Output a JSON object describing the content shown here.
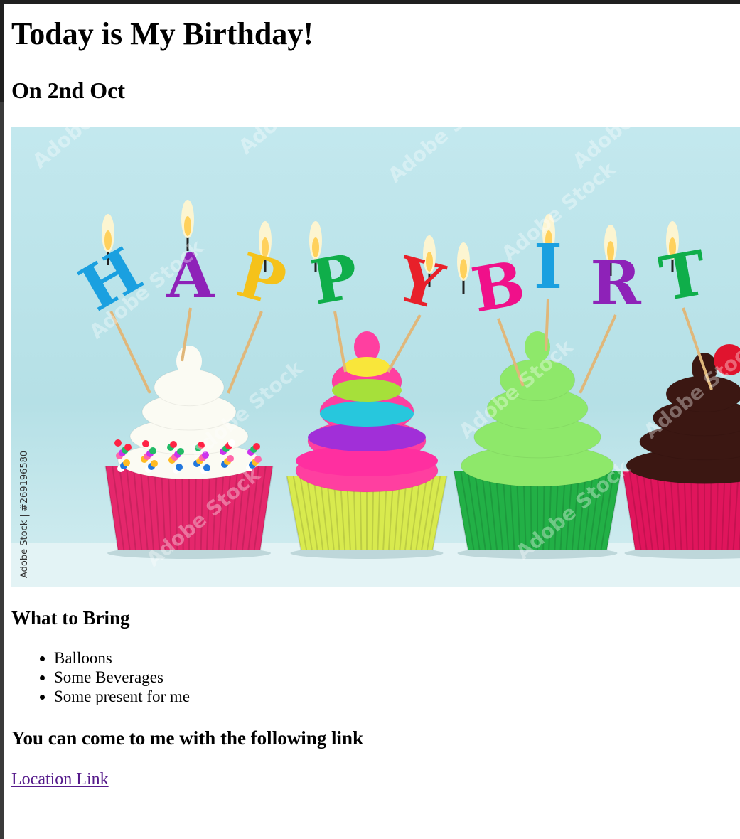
{
  "page": {
    "title": "Today is My Birthday!",
    "subtitle": "On 2nd Oct"
  },
  "hero": {
    "candle_letters": [
      "H",
      "A",
      "P",
      "P",
      "Y",
      "B",
      "I",
      "R",
      "T"
    ],
    "candle_colors": [
      "#1aa0e0",
      "#8e22b8",
      "#f5c21a",
      "#0fae4a",
      "#e8202a",
      "#f0108a",
      "#1aa0e0",
      "#8e22b8",
      "#0fae4a"
    ],
    "cupcakes": [
      {
        "frosting": "#fbfbf3",
        "wrapper": "#e5276c"
      },
      {
        "frosting": "#ff3fa0",
        "wrapper": "#d8ea4e"
      },
      {
        "frosting": "#8ee86a",
        "wrapper": "#22b046"
      },
      {
        "frosting": "#3b1712",
        "wrapper": "#e0155c"
      }
    ],
    "watermark_text": "Adobe Stock",
    "stock_id_text": "Adobe Stock | #269196580"
  },
  "bring": {
    "heading": "What to Bring",
    "items": [
      "Balloons",
      "Some Beverages",
      "Some present for me"
    ]
  },
  "location": {
    "heading": "You can come to me with the following link",
    "link_text": "Location Link",
    "link_color": "#551a8b"
  }
}
